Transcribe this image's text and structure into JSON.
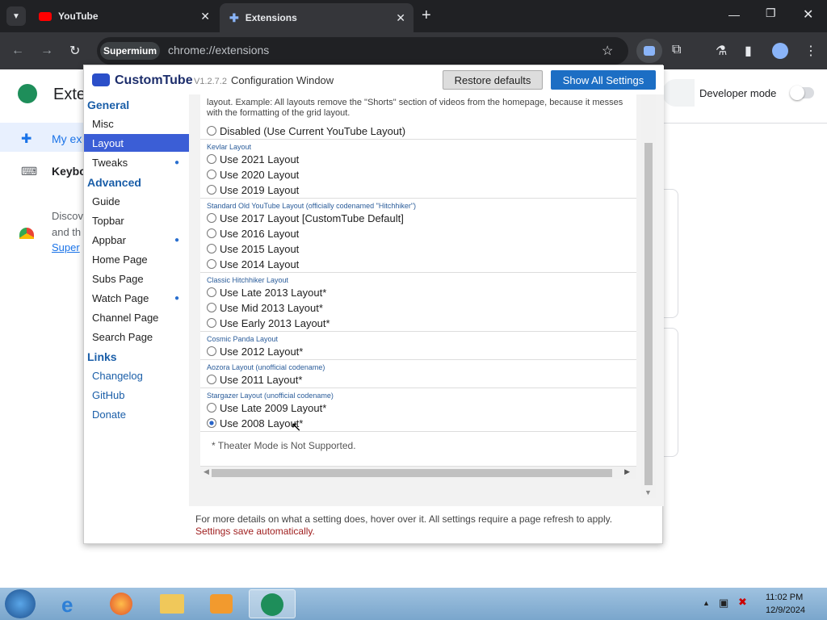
{
  "browser": {
    "tabs": [
      {
        "label": "YouTube"
      },
      {
        "label": "Extensions"
      }
    ],
    "chip": "Supermium",
    "url": "chrome://extensions"
  },
  "ext_page": {
    "title": "Exte",
    "developer_mode": "Developer mode",
    "nav": [
      "My ex",
      "Keybo"
    ],
    "discover": [
      "Discov",
      "and th",
      "Super"
    ]
  },
  "popup": {
    "brand": "CustomTube",
    "version": "V1.2.7.2",
    "subtitle": "Configuration Window",
    "restore": "Restore defaults",
    "show_all": "Show All Settings",
    "sidebar": {
      "general": "General",
      "advanced": "Advanced",
      "links": "Links",
      "general_items": [
        "Misc",
        "Layout",
        "Tweaks"
      ],
      "advanced_items": [
        "Guide",
        "Topbar",
        "Appbar",
        "Home Page",
        "Subs Page",
        "Watch Page",
        "Channel Page",
        "Search Page"
      ],
      "link_items": [
        "Changelog",
        "GitHub",
        "Donate"
      ]
    },
    "intro": "layout. Example: All layouts remove the \"Shorts\" section of videos from the homepage, because it messes with the formatting of the grid layout.",
    "disabled": "Disabled (Use Current YouTube Layout)",
    "groups": [
      {
        "name": "Kevlar Layout",
        "options": [
          "Use 2021 Layout",
          "Use 2020 Layout",
          "Use 2019 Layout"
        ]
      },
      {
        "name": "Standard Old YouTube Layout (officially codenamed \"Hitchhiker\")",
        "options": [
          "Use 2017 Layout [CustomTube Default]",
          "Use 2016 Layout",
          "Use 2015 Layout",
          "Use 2014 Layout"
        ]
      },
      {
        "name": "Classic Hitchhiker Layout",
        "options": [
          "Use Late 2013 Layout*",
          "Use Mid 2013 Layout*",
          "Use Early 2013 Layout*"
        ]
      },
      {
        "name": "Cosmic Panda Layout",
        "options": [
          "Use 2012 Layout*"
        ]
      },
      {
        "name": "Aozora Layout (unofficial codename)",
        "options": [
          "Use 2011 Layout*"
        ]
      },
      {
        "name": "Stargazer Layout (unofficial codename)",
        "options": [
          "Use Late 2009 Layout*",
          "Use 2008 Layout*"
        ]
      }
    ],
    "selected": "Use 2008 Layout*",
    "note": "* Theater Mode is Not Supported.",
    "footer1": "For more details on what a setting does, hover over it. All settings require a page refresh to apply.",
    "footer2": "Settings save automatically."
  },
  "taskbar": {
    "time": "11:02 PM",
    "date": "12/9/2024"
  }
}
